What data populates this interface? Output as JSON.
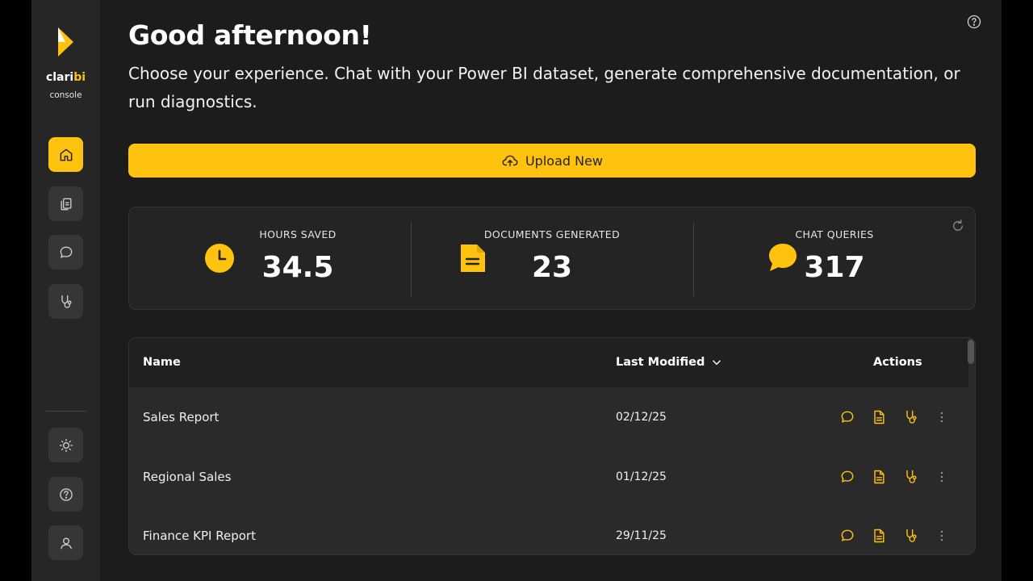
{
  "sidebar": {
    "brand_prefix": "clari",
    "brand_highlight": "bi",
    "brand_sub": "console",
    "nav": [
      {
        "id": "home",
        "icon": "home-icon",
        "active": true
      },
      {
        "id": "documents",
        "icon": "documents-icon",
        "active": false
      },
      {
        "id": "chat",
        "icon": "chat-icon",
        "active": false
      },
      {
        "id": "diagnostics",
        "icon": "stethoscope-icon",
        "active": false
      }
    ],
    "bottom": [
      {
        "id": "theme",
        "icon": "sun-icon"
      },
      {
        "id": "help",
        "icon": "help-icon"
      },
      {
        "id": "profile",
        "icon": "user-icon"
      }
    ]
  },
  "header": {
    "greeting": "Good afternoon!",
    "subtitle": "Choose your experience. Chat with your Power BI dataset, generate comprehensive documentation, or run diagnostics."
  },
  "upload": {
    "label": "Upload New",
    "icon": "cloud-upload-icon"
  },
  "stats": [
    {
      "label": "HOURS SAVED",
      "value": "34.5",
      "icon": "clock-icon"
    },
    {
      "label": "DOCUMENTS GENERATED",
      "value": "23",
      "icon": "document-icon"
    },
    {
      "label": "CHAT QUERIES",
      "value": "317",
      "icon": "chat-bubble-icon"
    }
  ],
  "table": {
    "columns": {
      "name": "Name",
      "modified": "Last Modified",
      "actions": "Actions"
    },
    "rows": [
      {
        "name": "Sales Report",
        "modified": "02/12/25"
      },
      {
        "name": "Regional Sales",
        "modified": "01/12/25"
      },
      {
        "name": "Finance KPI Report",
        "modified": "29/11/25"
      }
    ]
  },
  "colors": {
    "accent": "#ffc20e",
    "background": "#1c1c1c",
    "sidebar": "#262626",
    "card": "#242424"
  }
}
